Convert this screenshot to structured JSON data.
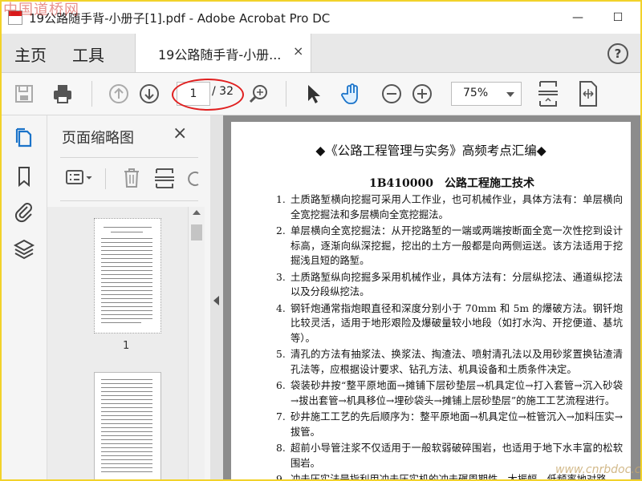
{
  "window": {
    "title": "19公路随手背-小册子[1].pdf - Adobe Acrobat Pro DC",
    "minimize": "—",
    "maximize": "☐"
  },
  "watermarks": {
    "top_left": "中国道桥网",
    "bottom_right": "www.cnrbdoc.com"
  },
  "nav": {
    "home": "主页",
    "tools": "工具",
    "tab_label": "19公路随手背-小册...",
    "tab_close": "×",
    "help": "?"
  },
  "toolbar": {
    "page_current": "1",
    "page_total": "/ 32",
    "zoom": "75%"
  },
  "panel": {
    "title": "页面缩略图",
    "close": "×",
    "thumb_page_label": "1"
  },
  "document": {
    "title": "◆《公路工程管理与实务》高频考点汇编◆",
    "subtitle": "1B410000　公路工程施工技术",
    "items": [
      {
        "num": "1.",
        "text": "土质路堑横向挖掘可采用人工作业，也可机械作业，具体方法有：单层横向全宽挖掘法和多层横向全宽挖掘法。"
      },
      {
        "num": "2.",
        "text": "单层横向全宽挖掘法：从开挖路堑的一端或两端按断面全宽一次性挖到设计标高，逐渐向纵深挖掘，挖出的土方一般都是向两侧运送。该方法适用于挖掘浅且短的路堑。"
      },
      {
        "num": "3.",
        "text": "土质路堑纵向挖掘多采用机械作业，具体方法有：分层纵挖法、通道纵挖法以及分段纵挖法。"
      },
      {
        "num": "4.",
        "text": "钢钎炮通常指炮眼直径和深度分别小于 70mm 和 5m 的爆破方法。钢钎炮比较灵活，适用于地形艰险及爆破量较小地段（如打水沟、开挖便道、基坑等）。"
      },
      {
        "num": "5.",
        "text": "清孔的方法有抽浆法、换浆法、掏渣法、喷射清孔法以及用砂浆置换钻渣清孔法等，应根据设计要求、钻孔方法、机具设备和土质条件决定。"
      },
      {
        "num": "6.",
        "text": "袋装砂井按“整平原地面→摊铺下层砂垫层→机具定位→打入套管→沉入砂袋→拔出套管→机具移位→埋砂袋头→摊铺上层砂垫层”的施工工艺流程进行。"
      },
      {
        "num": "7.",
        "text": "砂井施工工艺的先后顺序为：整平原地面→机具定位→桩管沉入→加料压实→拔管。"
      },
      {
        "num": "8.",
        "text": "超前小导管注浆不仅适用于一般软弱破碎围岩，也适用于地下水丰富的松软围岩。"
      },
      {
        "num": "9.",
        "text": "冲击压实法是指利用冲击压实机的冲击碾周期性、大振幅、低频率地对路"
      }
    ]
  }
}
